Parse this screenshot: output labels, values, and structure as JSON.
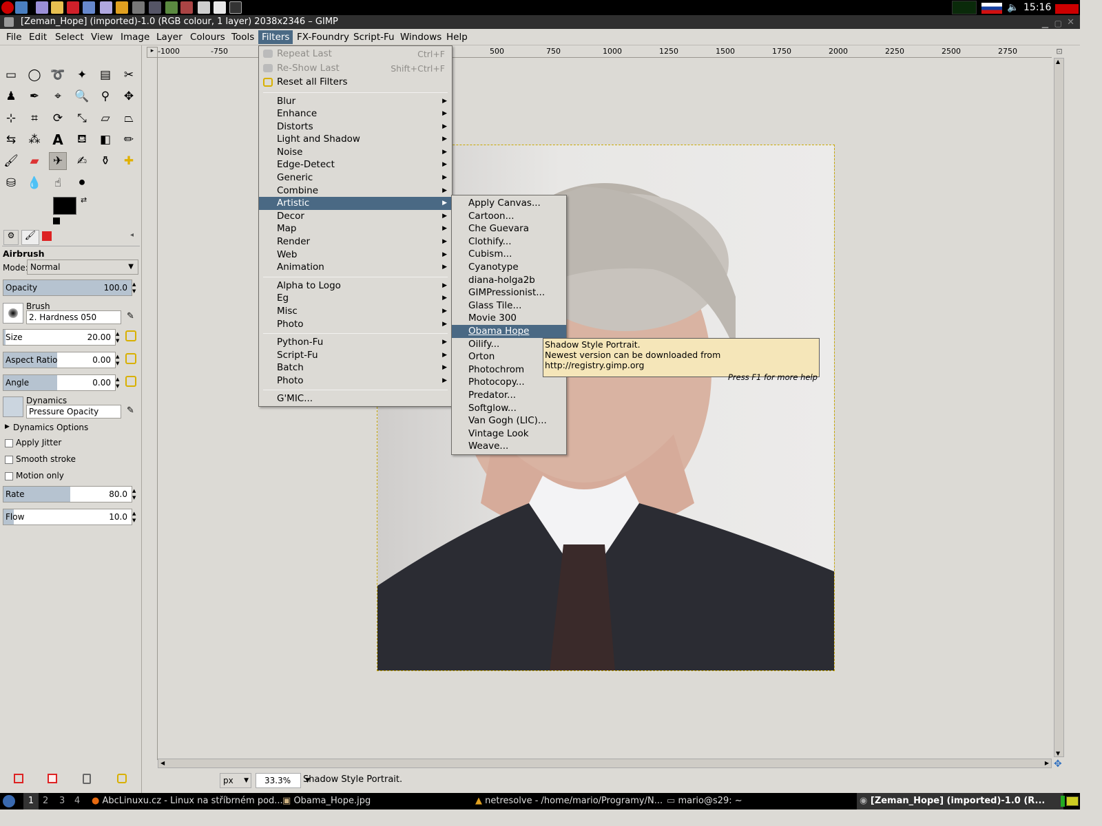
{
  "topbar": {
    "clock": "15:16"
  },
  "window": {
    "title": "[Zeman_Hope] (imported)-1.0 (RGB colour, 1 layer) 2038x2346 – GIMP"
  },
  "menubar": {
    "items": [
      "File",
      "Edit",
      "Select",
      "View",
      "Image",
      "Layer",
      "Colours",
      "Tools",
      "Filters",
      "FX-Foundry",
      "Script-Fu",
      "Windows",
      "Help"
    ]
  },
  "tool_options": {
    "tool_name": "Airbrush",
    "mode_label": "Mode:",
    "mode_value": "Normal",
    "opacity_label": "Opacity",
    "opacity_value": "100.0",
    "brush_label": "Brush",
    "brush_value": "2. Hardness 050",
    "size_label": "Size",
    "size_value": "20.00",
    "aspect_label": "Aspect Ratio",
    "aspect_value": "0.00",
    "angle_label": "Angle",
    "angle_value": "0.00",
    "dynamics_label": "Dynamics",
    "dynamics_value": "Pressure Opacity",
    "dynamics_options": "Dynamics Options",
    "apply_jitter": "Apply Jitter",
    "smooth_stroke": "Smooth stroke",
    "motion_only": "Motion only",
    "rate_label": "Rate",
    "rate_value": "80.0",
    "flow_label": "Flow",
    "flow_value": "10.0"
  },
  "ruler": {
    "h_ticks": [
      "-1000",
      "-750",
      "500",
      "750",
      "1000",
      "1250",
      "1500",
      "1750",
      "2000",
      "2250",
      "2500",
      "2750"
    ]
  },
  "filters_menu": {
    "repeat_last": "Repeat Last",
    "repeat_last_acc": "Ctrl+F",
    "reshow_last": "Re-Show Last",
    "reshow_last_acc": "Shift+Ctrl+F",
    "reset_all": "Reset all Filters",
    "group1": [
      "Blur",
      "Enhance",
      "Distorts",
      "Light and Shadow",
      "Noise",
      "Edge-Detect",
      "Generic",
      "Combine",
      "Artistic",
      "Decor",
      "Map",
      "Render",
      "Web",
      "Animation"
    ],
    "group2": [
      "Alpha to Logo",
      "Eg",
      "Misc",
      "Photo"
    ],
    "group3": [
      "Python-Fu",
      "Script-Fu",
      "Batch",
      "Photo"
    ],
    "gmic": "G'MIC..."
  },
  "artistic_menu": {
    "items": [
      "Apply Canvas...",
      "Cartoon...",
      "Che Guevara",
      "Clothify...",
      "Cubism...",
      "Cyanotype",
      "diana-holga2b",
      "GIMPressionist...",
      "Glass Tile...",
      "Movie 300",
      "Obama Hope",
      "Oilify...",
      "Orton",
      "Photochrom",
      "Photocopy...",
      "Predator...",
      "Softglow...",
      "Van Gogh (LIC)...",
      "Vintage Look",
      "Weave..."
    ],
    "highlighted": "Obama Hope"
  },
  "tooltip": {
    "line1": "Shadow Style Portrait.",
    "line2": "Newest version can be downloaded from http://registry.gimp.org",
    "help": "Press F1 for more help"
  },
  "statusbar": {
    "unit": "px",
    "zoom": "33.3%",
    "message": "Shadow Style Portrait."
  },
  "taskbar": {
    "workspaces": [
      "1",
      "2",
      "3",
      "4"
    ],
    "tasks": [
      "AbcLinuxu.cz - Linux na stříbrném pod...",
      "Obama_Hope.jpg",
      "netresolve - /home/mario/Programy/N...",
      "mario@s29: ~",
      "[Zeman_Hope] (imported)-1.0 (R..."
    ]
  },
  "colors": {
    "highlight": "#4a6984",
    "tooltip_bg": "#f5e6b9",
    "selection_border": "#c8a800"
  }
}
